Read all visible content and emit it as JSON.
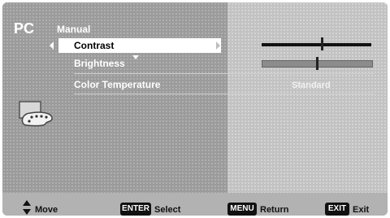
{
  "source": "PC",
  "section": "Manual",
  "menu": {
    "items": [
      {
        "label": "Contrast",
        "selected": true,
        "level": 0.55
      },
      {
        "label": "Brightness",
        "selected": false,
        "level": 0.5
      },
      {
        "label": "Color Temperature",
        "selected": false,
        "value": "Standard"
      }
    ]
  },
  "icons": {
    "palette": "palette-icon",
    "updown": "up-down-arrow-icon"
  },
  "footer": {
    "move_label": "Move",
    "enter_key": "ENTER",
    "select_label": "Select",
    "menu_key": "MENU",
    "return_label": "Return",
    "exit_key": "EXIT",
    "exit_label": "Exit"
  },
  "colors": {
    "selected_bg": "#ffffff",
    "panel_bg": "#9b9b9b",
    "right_panel_bg": "#c2c2c2",
    "footer_bg": "#b2b2b2"
  }
}
